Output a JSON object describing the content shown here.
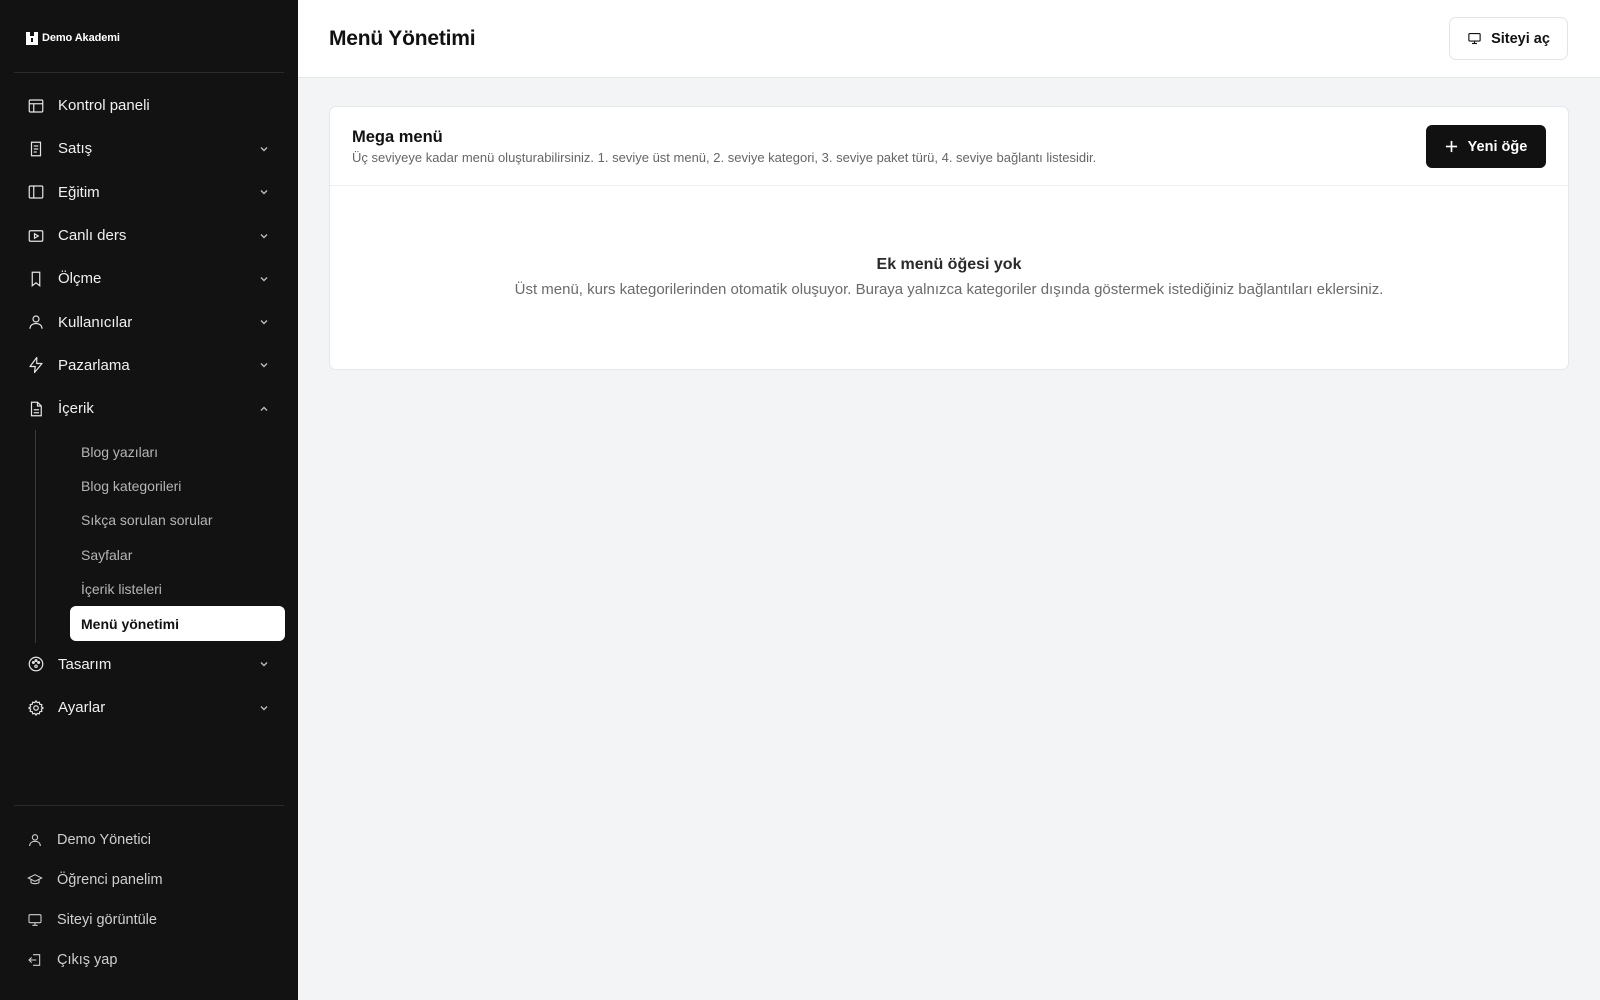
{
  "brand": {
    "name": "Demo Akademi"
  },
  "sidebar": {
    "items": [
      {
        "label": "Kontrol paneli",
        "icon": "layout-icon"
      },
      {
        "label": "Satış",
        "icon": "receipt-icon"
      },
      {
        "label": "Eğitim",
        "icon": "book-panel-icon"
      },
      {
        "label": "Canlı ders",
        "icon": "video-icon"
      },
      {
        "label": "Ölçme",
        "icon": "bookmark-icon"
      },
      {
        "label": "Kullanıcılar",
        "icon": "user-icon"
      },
      {
        "label": "Pazarlama",
        "icon": "bolt-icon"
      },
      {
        "label": "İçerik",
        "icon": "document-icon"
      },
      {
        "label": "Tasarım",
        "icon": "palette-icon"
      },
      {
        "label": "Ayarlar",
        "icon": "gear-icon"
      }
    ],
    "content_sub": [
      "Blog yazıları",
      "Blog kategorileri",
      "Sıkça sorulan sorular",
      "Sayfalar",
      "İçerik listeleri",
      "Menü yönetimi"
    ],
    "bottom": [
      {
        "label": "Demo Yönetici",
        "icon": "user-icon"
      },
      {
        "label": "Öğrenci panelim",
        "icon": "graduation-cap-icon"
      },
      {
        "label": "Siteyi görüntüle",
        "icon": "monitor-icon"
      },
      {
        "label": "Çıkış yap",
        "icon": "logout-icon"
      }
    ]
  },
  "header": {
    "title": "Menü Yönetimi",
    "open_site_label": "Siteyi aç"
  },
  "card": {
    "title": "Mega menü",
    "subtitle": "Üç seviyeye kadar menü oluşturabilirsiniz. 1. seviye üst menü, 2. seviye kategori, 3. seviye paket türü, 4. seviye bağlantı listesidir.",
    "new_item_label": "Yeni öğe",
    "empty_title": "Ek menü öğesi yok",
    "empty_desc": "Üst menü, kurs kategorilerinden otomatik oluşuyor. Buraya yalnızca kategoriler dışında göstermek istediğiniz bağlantıları eklersiniz."
  },
  "colors": {
    "sidebar_bg": "#121212",
    "main_bg": "#f3f4f6",
    "accent": "#111111"
  }
}
